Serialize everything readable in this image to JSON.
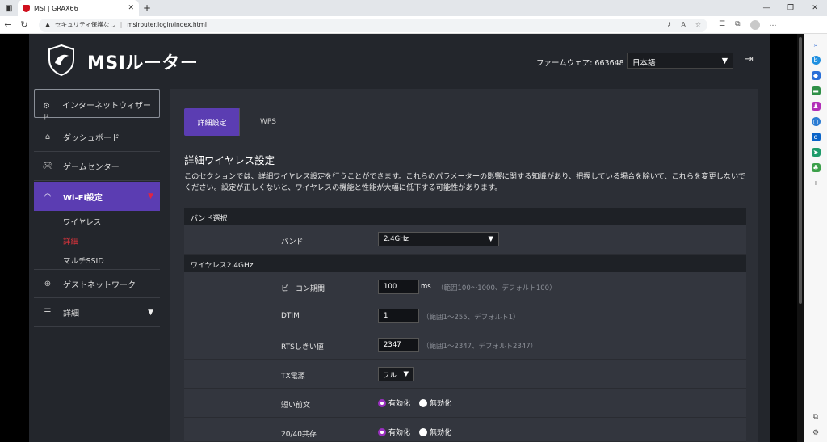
{
  "browser": {
    "tab_title": "MSI | GRAX66",
    "security_label": "セキュリティ保護なし",
    "url": "msirouter.login/index.html"
  },
  "header": {
    "brand": "MSIルーター",
    "firmware": "ファームウェア: 663648",
    "language": "日本語"
  },
  "sidebar": {
    "wizard": "インターネットウィザー",
    "wizard_overflow": "ド",
    "dashboard": "ダッシュボード",
    "game_center": "ゲームセンター",
    "wifi": "Wi-Fi設定",
    "sub_wireless": "ワイヤレス",
    "sub_detail": "詳細",
    "sub_multi_ssid": "マルチSSID",
    "guest": "ゲストネットワーク",
    "detail": "詳細"
  },
  "tabs": {
    "advanced": "詳細設定",
    "wps": "WPS"
  },
  "main": {
    "title": "詳細ワイヤレス設定",
    "description": "このセクションでは、詳細ワイヤレス設定を行うことができます。これらのパラメーターの影響に関する知識があり、把握している場合を除いて、これらを変更しないでください。設定が正しくないと、ワイヤレスの機能と性能が大幅に低下する可能性があります。",
    "band_section": "バンド選択",
    "band_label": "バンド",
    "band_value": "2.4GHz",
    "wireless_section": "ワイヤレス2.4GHz",
    "beacon_label": "ビーコン期間",
    "beacon_value": "100",
    "beacon_unit": "ms",
    "beacon_hint": "（範囲100～1000、デフォルト100）",
    "dtim_label": "DTIM",
    "dtim_value": "1",
    "dtim_hint": "（範囲1～255、デフォルト1）",
    "rts_label": "RTSしきい値",
    "rts_value": "2347",
    "rts_hint": "（範囲1～2347、デフォルト2347）",
    "tx_label": "TX電源",
    "tx_value": "フル",
    "preamble_label": "短い前文",
    "enable": "有効化",
    "disable": "無効化",
    "coexist_label": "20/40共存"
  }
}
